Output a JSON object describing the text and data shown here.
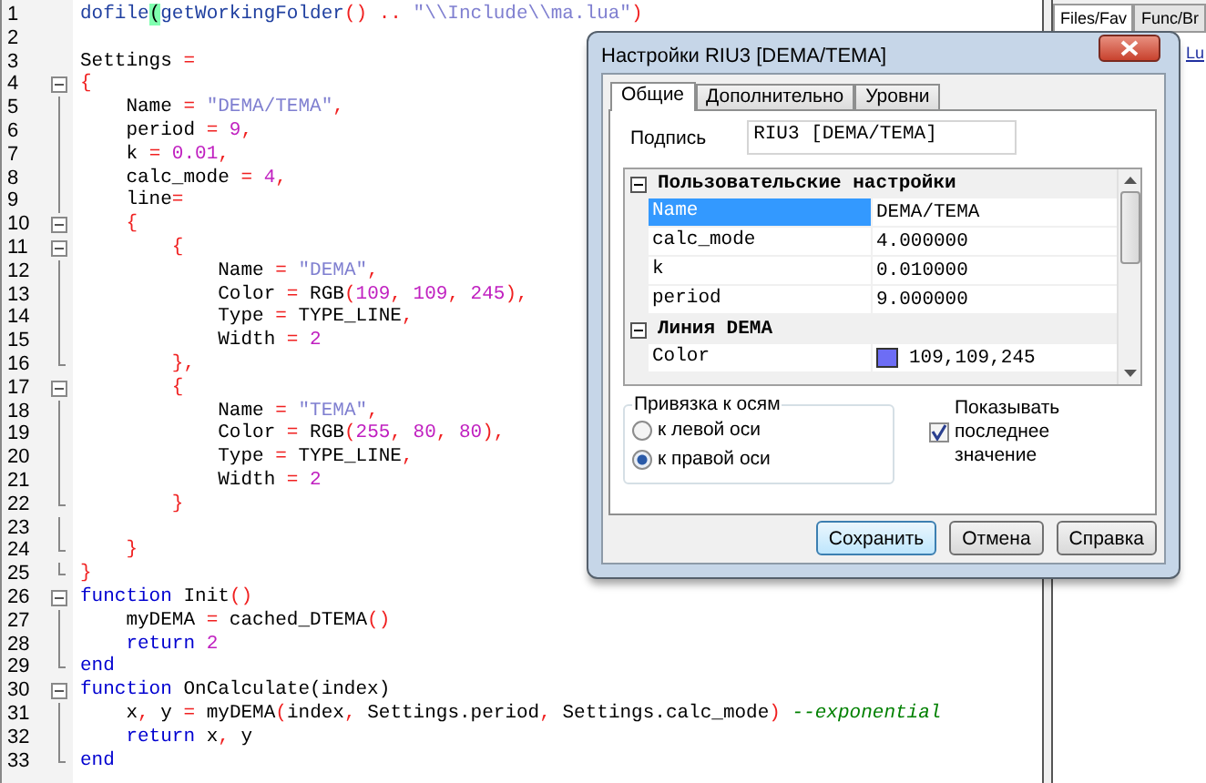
{
  "editor": {
    "lines": [
      {
        "number": "1",
        "tokens": [
          {
            "kind": "fn",
            "text": "dofile"
          },
          {
            "kind": "match",
            "text": "("
          },
          {
            "kind": "fn",
            "text": "getWorkingFolder"
          },
          {
            "kind": "op",
            "text": "() .. "
          },
          {
            "kind": "str",
            "text": "\"\\\\Include\\\\ma.lua\""
          },
          {
            "kind": "op",
            "text": ")"
          }
        ]
      },
      {
        "number": "2"
      },
      {
        "number": "3",
        "tokens": [
          {
            "kind": "id",
            "text": "Settings "
          },
          {
            "kind": "op",
            "text": "="
          }
        ]
      },
      {
        "number": "4",
        "kind": "box",
        "tokens": [
          {
            "kind": "op",
            "text": "{"
          }
        ]
      },
      {
        "number": "5",
        "kind": "bar",
        "tokens": [
          {
            "kind": "id",
            "text": "    Name "
          },
          {
            "kind": "op",
            "text": "= "
          },
          {
            "kind": "str",
            "text": "\"DEMA/TEMA\""
          },
          {
            "kind": "op",
            "text": ","
          }
        ]
      },
      {
        "number": "6",
        "kind": "bar",
        "tokens": [
          {
            "kind": "id",
            "text": "    period "
          },
          {
            "kind": "op",
            "text": "= "
          },
          {
            "kind": "num",
            "text": "9"
          },
          {
            "kind": "op",
            "text": ","
          }
        ]
      },
      {
        "number": "7",
        "kind": "bar",
        "tokens": [
          {
            "kind": "id",
            "text": "    k "
          },
          {
            "kind": "op",
            "text": "= "
          },
          {
            "kind": "num",
            "text": "0.01"
          },
          {
            "kind": "op",
            "text": ","
          }
        ]
      },
      {
        "number": "8",
        "kind": "bar",
        "tokens": [
          {
            "kind": "id",
            "text": "    calc_mode "
          },
          {
            "kind": "op",
            "text": "= "
          },
          {
            "kind": "num",
            "text": "4"
          },
          {
            "kind": "op",
            "text": ","
          }
        ]
      },
      {
        "number": "9",
        "kind": "bar",
        "tokens": [
          {
            "kind": "id",
            "text": "    line"
          },
          {
            "kind": "op",
            "text": "="
          }
        ]
      },
      {
        "number": "10",
        "kind": "box",
        "tokens": [
          {
            "kind": "op",
            "text": "    {"
          }
        ]
      },
      {
        "number": "11",
        "kind": "box",
        "tokens": [
          {
            "kind": "op",
            "text": "        {"
          }
        ]
      },
      {
        "number": "12",
        "kind": "bar",
        "tokens": [
          {
            "kind": "id",
            "text": "            Name "
          },
          {
            "kind": "op",
            "text": "= "
          },
          {
            "kind": "str",
            "text": "\"DEMA\""
          },
          {
            "kind": "op",
            "text": ","
          }
        ]
      },
      {
        "number": "13",
        "kind": "bar",
        "tokens": [
          {
            "kind": "id",
            "text": "            Color "
          },
          {
            "kind": "op",
            "text": "="
          },
          {
            "kind": "id",
            "text": " RGB"
          },
          {
            "kind": "op",
            "text": "("
          },
          {
            "kind": "num",
            "text": "109"
          },
          {
            "kind": "op",
            "text": ", "
          },
          {
            "kind": "num",
            "text": "109"
          },
          {
            "kind": "op",
            "text": ", "
          },
          {
            "kind": "num",
            "text": "245"
          },
          {
            "kind": "op",
            "text": "),"
          }
        ]
      },
      {
        "number": "14",
        "kind": "bar",
        "tokens": [
          {
            "kind": "id",
            "text": "            Type "
          },
          {
            "kind": "op",
            "text": "="
          },
          {
            "kind": "id",
            "text": " TYPE_LINE"
          },
          {
            "kind": "op",
            "text": ","
          }
        ]
      },
      {
        "number": "15",
        "kind": "bar",
        "tokens": [
          {
            "kind": "id",
            "text": "            Width "
          },
          {
            "kind": "op",
            "text": "= "
          },
          {
            "kind": "num",
            "text": "2"
          }
        ]
      },
      {
        "number": "16",
        "kind": "tick",
        "tokens": [
          {
            "kind": "op",
            "text": "        },"
          }
        ]
      },
      {
        "number": "17",
        "kind": "box",
        "tokens": [
          {
            "kind": "op",
            "text": "        {"
          }
        ]
      },
      {
        "number": "18",
        "kind": "bar",
        "tokens": [
          {
            "kind": "id",
            "text": "            Name "
          },
          {
            "kind": "op",
            "text": "= "
          },
          {
            "kind": "str",
            "text": "\"TEMA\""
          },
          {
            "kind": "op",
            "text": ","
          }
        ]
      },
      {
        "number": "19",
        "kind": "bar",
        "tokens": [
          {
            "kind": "id",
            "text": "            Color "
          },
          {
            "kind": "op",
            "text": "="
          },
          {
            "kind": "id",
            "text": " RGB"
          },
          {
            "kind": "op",
            "text": "("
          },
          {
            "kind": "num",
            "text": "255"
          },
          {
            "kind": "op",
            "text": ", "
          },
          {
            "kind": "num",
            "text": "80"
          },
          {
            "kind": "op",
            "text": ", "
          },
          {
            "kind": "num",
            "text": "80"
          },
          {
            "kind": "op",
            "text": "),"
          }
        ]
      },
      {
        "number": "20",
        "kind": "bar",
        "tokens": [
          {
            "kind": "id",
            "text": "            Type "
          },
          {
            "kind": "op",
            "text": "="
          },
          {
            "kind": "id",
            "text": " TYPE_LINE"
          },
          {
            "kind": "op",
            "text": ","
          }
        ]
      },
      {
        "number": "21",
        "kind": "bar",
        "tokens": [
          {
            "kind": "id",
            "text": "            Width "
          },
          {
            "kind": "op",
            "text": "= "
          },
          {
            "kind": "num",
            "text": "2"
          }
        ]
      },
      {
        "number": "22",
        "kind": "tick",
        "tokens": [
          {
            "kind": "op",
            "text": "        }"
          }
        ]
      },
      {
        "number": "23",
        "kind": "bar"
      },
      {
        "number": "24",
        "kind": "tick",
        "tokens": [
          {
            "kind": "op",
            "text": "    }"
          }
        ]
      },
      {
        "number": "25",
        "kind": "end",
        "tokens": [
          {
            "kind": "op",
            "text": "}"
          }
        ]
      },
      {
        "number": "26",
        "kind": "box",
        "tokens": [
          {
            "kind": "kw",
            "text": "function"
          },
          {
            "kind": "id",
            "text": " Init"
          },
          {
            "kind": "op",
            "text": "()"
          }
        ]
      },
      {
        "number": "27",
        "kind": "bar",
        "tokens": [
          {
            "kind": "id",
            "text": "    myDEMA "
          },
          {
            "kind": "op",
            "text": "="
          },
          {
            "kind": "id",
            "text": " cached_DTEMA"
          },
          {
            "kind": "op",
            "text": "()"
          }
        ]
      },
      {
        "number": "28",
        "kind": "bar",
        "tokens": [
          {
            "kind": "kw",
            "text": "    return"
          },
          {
            "kind": "num",
            "text": " 2"
          }
        ]
      },
      {
        "number": "29",
        "kind": "end",
        "tokens": [
          {
            "kind": "kw",
            "text": "end"
          }
        ]
      },
      {
        "number": "30",
        "kind": "box",
        "tokens": [
          {
            "kind": "kw",
            "text": "function"
          },
          {
            "kind": "id",
            "text": " OnCalculate(index)"
          }
        ]
      },
      {
        "number": "31",
        "kind": "bar",
        "tokens": [
          {
            "kind": "id",
            "text": "    x"
          },
          {
            "kind": "op",
            "text": ","
          },
          {
            "kind": "id",
            "text": " y "
          },
          {
            "kind": "op",
            "text": "="
          },
          {
            "kind": "id",
            "text": " myDEMA"
          },
          {
            "kind": "op",
            "text": "("
          },
          {
            "kind": "id",
            "text": "index"
          },
          {
            "kind": "op",
            "text": ","
          },
          {
            "kind": "id",
            "text": " Settings.period"
          },
          {
            "kind": "op",
            "text": ","
          },
          {
            "kind": "id",
            "text": " Settings.calc_mode"
          },
          {
            "kind": "op",
            "text": ") "
          },
          {
            "kind": "cm",
            "text": "--exponential"
          }
        ]
      },
      {
        "number": "32",
        "kind": "bar",
        "tokens": [
          {
            "kind": "kw",
            "text": "    return"
          },
          {
            "kind": "id",
            "text": " x"
          },
          {
            "kind": "op",
            "text": ","
          },
          {
            "kind": "id",
            "text": " y"
          }
        ]
      },
      {
        "number": "33",
        "kind": "end",
        "tokens": [
          {
            "kind": "kw",
            "text": "end"
          }
        ]
      }
    ]
  },
  "side_panel": {
    "tabs": [
      {
        "label": "Files/Fav",
        "selected": true
      },
      {
        "label": "Func/Br",
        "selected": false
      }
    ],
    "link": "Lu"
  },
  "dialog": {
    "title": "Настройки RIU3 [DEMA/TEMA]",
    "tabs": [
      {
        "label": "Общие",
        "selected": true
      },
      {
        "label": "Дополнительно",
        "selected": false
      },
      {
        "label": "Уровни",
        "selected": false
      }
    ],
    "caption": {
      "label": "Подпись",
      "value": "RIU3 [DEMA/TEMA]"
    },
    "property_grid": [
      {
        "title": "Пользовательские настройки",
        "expanded": true,
        "rows": [
          {
            "name": "Name",
            "value": "DEMA/TEMA",
            "selected": true
          },
          {
            "name": "calc_mode",
            "value": "4.000000",
            "selected": false
          },
          {
            "name": "k",
            "value": "0.010000",
            "selected": false
          },
          {
            "name": "period",
            "value": "9.000000",
            "selected": false
          }
        ]
      },
      {
        "title": "Линия DEMA",
        "expanded": true,
        "rows": [
          {
            "name": "Color",
            "value": "109,109,245",
            "selected": false,
            "color": "#6d6df5"
          }
        ]
      }
    ],
    "axis_group": {
      "title": "Привязка к осям",
      "options": [
        {
          "label": "к левой оси",
          "selected": false
        },
        {
          "label": "к правой оси",
          "selected": true
        }
      ]
    },
    "show_last_value": {
      "label": "Показывать последнее значение",
      "checked": true
    },
    "buttons": [
      {
        "label": "Сохранить",
        "default": true
      },
      {
        "label": "Отмена",
        "default": false
      },
      {
        "label": "Справка",
        "default": false
      }
    ]
  }
}
